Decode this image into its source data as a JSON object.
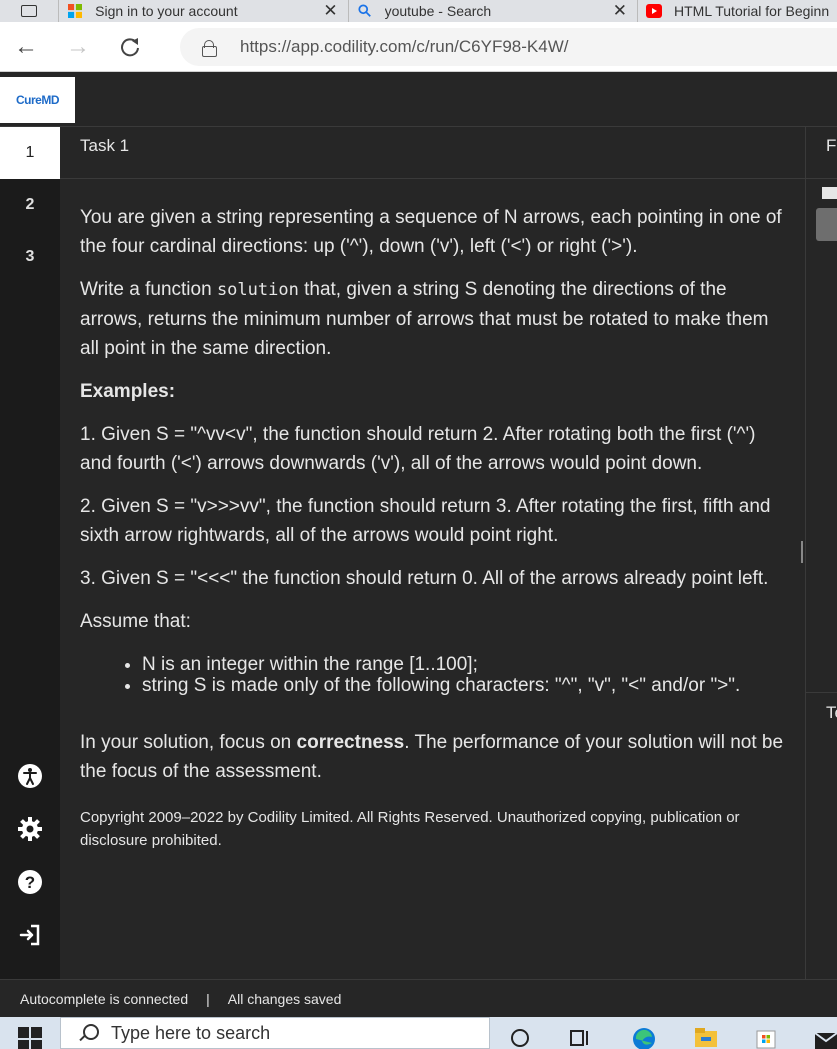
{
  "browser": {
    "tabs": [
      {
        "label": "Sign in to your account"
      },
      {
        "label": "youtube - Search"
      },
      {
        "label": "HTML Tutorial for Beginners"
      }
    ],
    "url": "https://app.codility.com/c/run/C6YF98-K4W/"
  },
  "app": {
    "logo_text": "CureMD",
    "task_title": "Task 1",
    "nav_items": [
      "1",
      "2",
      "3"
    ],
    "right_panel_top": "Fi",
    "right_panel_bottom": "Te"
  },
  "task": {
    "p1": "You are given a string representing a sequence of N arrows, each pointing in one of the four cardinal directions: up ('^'), down ('v'), left ('<') or right ('>').",
    "p2_before": "Write a function ",
    "p2_code": "solution",
    "p2_after": " that, given a string S denoting the directions of the arrows, returns the minimum number of arrows that must be rotated to make them all point in the same direction.",
    "examples_heading": "Examples:",
    "ex1": "1. Given S = \"^vv<v\", the function should return 2. After rotating both the first ('^') and fourth ('<') arrows downwards ('v'), all of the arrows would point down.",
    "ex2": "2. Given S = \"v>>>vv\", the function should return 3. After rotating the first, fifth and sixth arrow rightwards, all of the arrows would point right.",
    "ex3": "3. Given S = \"<<<\" the function should return 0. All of the arrows already point left.",
    "assume": "Assume that:",
    "bullets": [
      "N is an integer within the range [1..100];",
      "string S is made only of the following characters: \"^\", \"v\", \"<\" and/or \">\"."
    ],
    "focus_before": "In your solution, focus on ",
    "focus_bold": "correctness",
    "focus_after": ". The performance of your solution will not be the focus of the assessment.",
    "copyright": "Copyright 2009–2022 by Codility Limited. All Rights Reserved. Unauthorized copying, publication or disclosure prohibited."
  },
  "status": {
    "autocomplete": "Autocomplete is connected",
    "separator": "|",
    "saved": "All changes saved"
  },
  "taskbar": {
    "search_placeholder": "Type here to search"
  },
  "colors": {
    "background": "#262626",
    "rail": "#1b1b1b",
    "text": "#e6e6e6",
    "logo_blue": "#1e6bc8"
  }
}
